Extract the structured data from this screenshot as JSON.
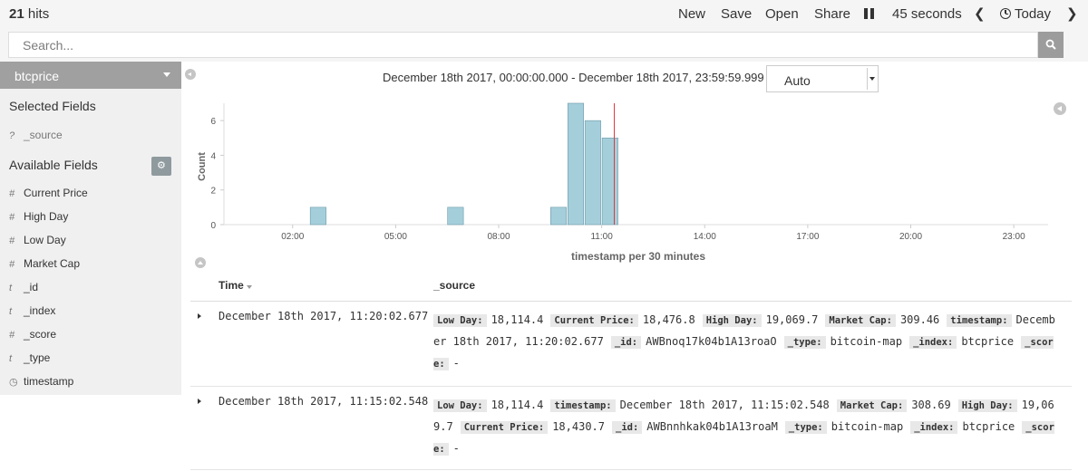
{
  "topbar": {
    "hits_count": "21",
    "hits_label": "hits",
    "nav": [
      "New",
      "Save",
      "Open",
      "Share"
    ],
    "refresh_interval": "45 seconds",
    "time_label": "Today"
  },
  "search": {
    "placeholder": "Search..."
  },
  "sidebar": {
    "index_pattern": "btcprice",
    "selected_heading": "Selected Fields",
    "selected_fields": [
      {
        "type": "?",
        "name": "_source"
      }
    ],
    "available_heading": "Available Fields",
    "available_fields": [
      {
        "type": "#",
        "name": "Current Price"
      },
      {
        "type": "#",
        "name": "High Day"
      },
      {
        "type": "#",
        "name": "Low Day"
      },
      {
        "type": "#",
        "name": "Market Cap"
      },
      {
        "type": "t",
        "name": "_id"
      },
      {
        "type": "t",
        "name": "_index"
      },
      {
        "type": "#",
        "name": "_score"
      },
      {
        "type": "t",
        "name": "_type"
      },
      {
        "type": "clock",
        "name": "timestamp"
      }
    ]
  },
  "histogram": {
    "time_range": "December 18th 2017, 00:00:00.000 - December 18th 2017, 23:59:59.999 —",
    "interval": "Auto"
  },
  "chart_data": {
    "type": "bar",
    "ylabel": "Count",
    "xlabel": "timestamp per 30 minutes",
    "x_ticks": [
      "02:00",
      "05:00",
      "08:00",
      "11:00",
      "14:00",
      "17:00",
      "20:00",
      "23:00"
    ],
    "y_ticks": [
      0,
      2,
      4,
      6
    ],
    "xlim_hours": [
      0,
      24
    ],
    "ylim": [
      0,
      7
    ],
    "bars": [
      {
        "start": "02:30",
        "count": 1
      },
      {
        "start": "06:30",
        "count": 1
      },
      {
        "start": "09:30",
        "count": 1
      },
      {
        "start": "10:00",
        "count": 7
      },
      {
        "start": "10:30",
        "count": 6
      },
      {
        "start": "11:00",
        "count": 5
      }
    ],
    "current_time_marker": "11:22",
    "bar_color": "#a5cedb",
    "bar_stroke": "#6b9aa8",
    "marker_color": "#e0393e"
  },
  "table": {
    "col_time": "Time",
    "col_source": "_source",
    "rows": [
      {
        "time": "December 18th 2017, 11:20:02.677",
        "fields": [
          {
            "k": "Low Day:",
            "v": "18,114.4"
          },
          {
            "k": "Current Price:",
            "v": "18,476.8"
          },
          {
            "k": "High Day:",
            "v": "19,069.7"
          },
          {
            "k": "Market Cap:",
            "v": "309.46"
          },
          {
            "k": "timestamp:",
            "v": "December 18th 2017, 11:20:02.677"
          },
          {
            "k": "_id:",
            "v": "AWBnoq17k04b1A13roaO"
          },
          {
            "k": "_type:",
            "v": "bitcoin-map"
          },
          {
            "k": "_index:",
            "v": "btcprice"
          },
          {
            "k": "_score:",
            "v": "-"
          }
        ]
      },
      {
        "time": "December 18th 2017, 11:15:02.548",
        "fields": [
          {
            "k": "Low Day:",
            "v": "18,114.4"
          },
          {
            "k": "timestamp:",
            "v": "December 18th 2017, 11:15:02.548"
          },
          {
            "k": "Market Cap:",
            "v": "308.69"
          },
          {
            "k": "High Day:",
            "v": "19,069.7"
          },
          {
            "k": "Current Price:",
            "v": "18,430.7"
          },
          {
            "k": "_id:",
            "v": "AWBnnhkak04b1A13roaM"
          },
          {
            "k": "_type:",
            "v": "bitcoin-map"
          },
          {
            "k": "_index:",
            "v": "btcprice"
          },
          {
            "k": "_score:",
            "v": "-"
          }
        ]
      }
    ]
  }
}
